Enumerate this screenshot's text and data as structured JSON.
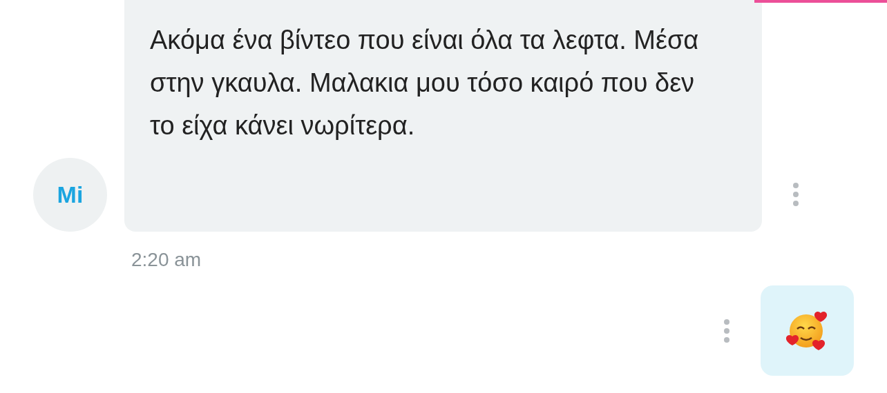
{
  "incoming": {
    "avatar": "Mi",
    "text": "Ακόμα ένα βίντεο που είναι όλα τα λεφτα. Μέσα στην γκαυλα. Μαλακια μου τόσο καιρό που δεν το είχα κάνει νωρίτερα.",
    "time": "2:20 am"
  },
  "outgoing": {
    "kind": "emoji"
  }
}
